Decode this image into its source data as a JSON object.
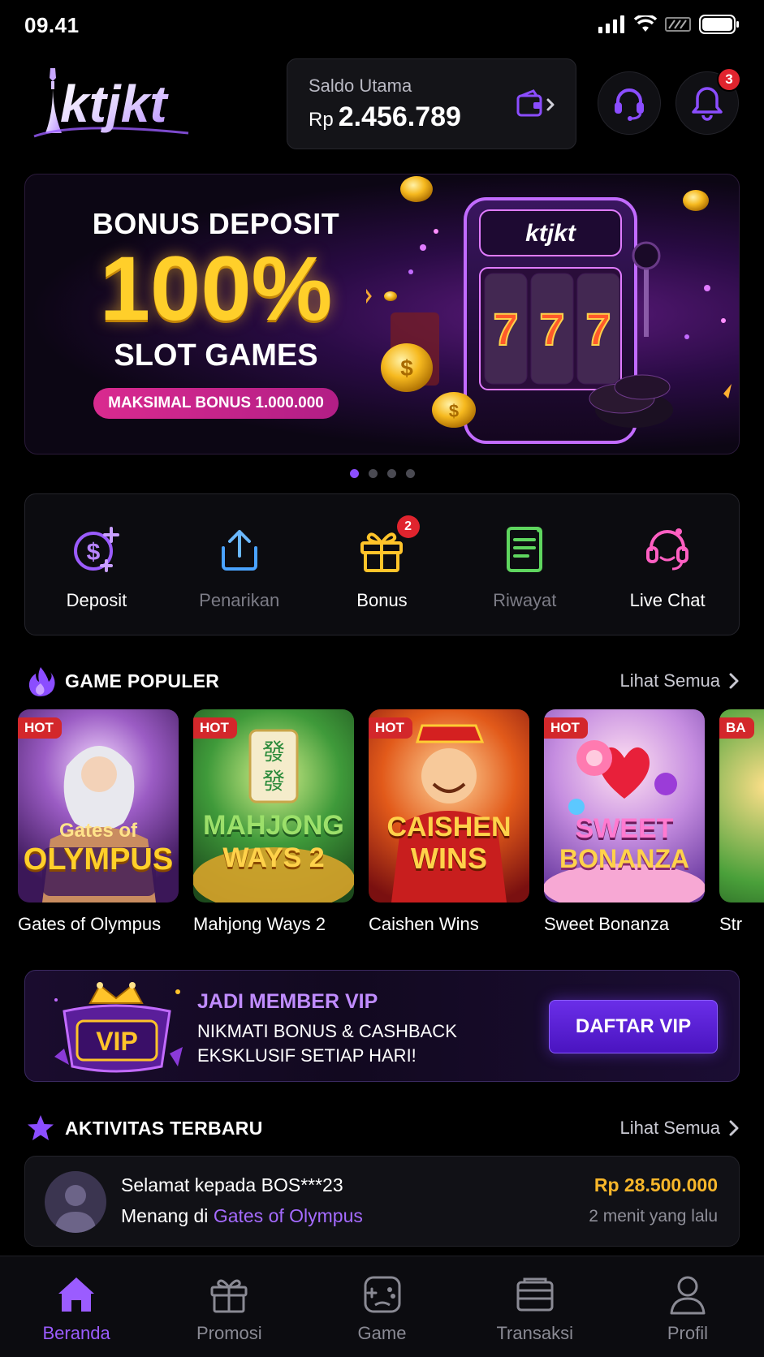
{
  "status_bar": {
    "time": "09.41"
  },
  "header": {
    "logo_text": "ktjkt",
    "balance_label": "Saldo Utama",
    "balance_currency": "Rp",
    "balance_value": "2.456.789",
    "notification_count": "3"
  },
  "banner": {
    "line1": "BONUS DEPOSIT",
    "big": "100%",
    "line3": "SLOT GAMES",
    "pill": "MAKSIMAL BONUS 1.000.000",
    "machine_logo": "ktjkt",
    "active_slide": 1,
    "slide_count": 4
  },
  "quick_actions": [
    {
      "label": "Deposit",
      "icon": "deposit-coin-icon",
      "dim": false
    },
    {
      "label": "Penarikan",
      "icon": "upload-icon",
      "dim": true
    },
    {
      "label": "Bonus",
      "icon": "gift-icon",
      "dim": false,
      "badge": "2"
    },
    {
      "label": "Riwayat",
      "icon": "history-list-icon",
      "dim": true
    },
    {
      "label": "Live Chat",
      "icon": "headset-icon",
      "dim": false
    }
  ],
  "popular": {
    "title": "GAME POPULER",
    "see_all": "Lihat Semua",
    "games": [
      {
        "name": "Gates of Olympus",
        "tag": "HOT",
        "art_line1": "Gates of",
        "art_line2": "OLYMPUS"
      },
      {
        "name": "Mahjong Ways 2",
        "tag": "HOT",
        "art_line1": "MAHJONG",
        "art_line2": "WAYS 2"
      },
      {
        "name": "Caishen Wins",
        "tag": "HOT",
        "art_line1": "CAISHEN",
        "art_line2": "WINS"
      },
      {
        "name": "Sweet Bonanza",
        "tag": "HOT",
        "art_line1": "SWEET",
        "art_line2": "BONANZA"
      },
      {
        "name": "Str",
        "tag": "BA"
      }
    ]
  },
  "vip": {
    "badge": "VIP",
    "title": "JADI MEMBER VIP",
    "line1": "NIKMATI BONUS & CASHBACK",
    "line2": "EKSKLUSIF SETIAP HARI!",
    "button": "DAFTAR VIP"
  },
  "activity": {
    "title": "AKTIVITAS TERBARU",
    "see_all": "Lihat Semua",
    "congrats_prefix": "Selamat kepada",
    "user": "BOS***23",
    "won_prefix": "Menang di",
    "game": "Gates of Olympus",
    "amount": "Rp 28.500.000",
    "time": "2 menit yang lalu"
  },
  "bottom_nav": [
    {
      "label": "Beranda",
      "active": true
    },
    {
      "label": "Promosi",
      "active": false
    },
    {
      "label": "Game",
      "active": false
    },
    {
      "label": "Transaksi",
      "active": false
    },
    {
      "label": "Profil",
      "active": false
    }
  ],
  "colors": {
    "accent": "#8b4dff",
    "gold": "#ffcf2a",
    "badge": "#e0242e",
    "amount": "#f7b62a"
  }
}
